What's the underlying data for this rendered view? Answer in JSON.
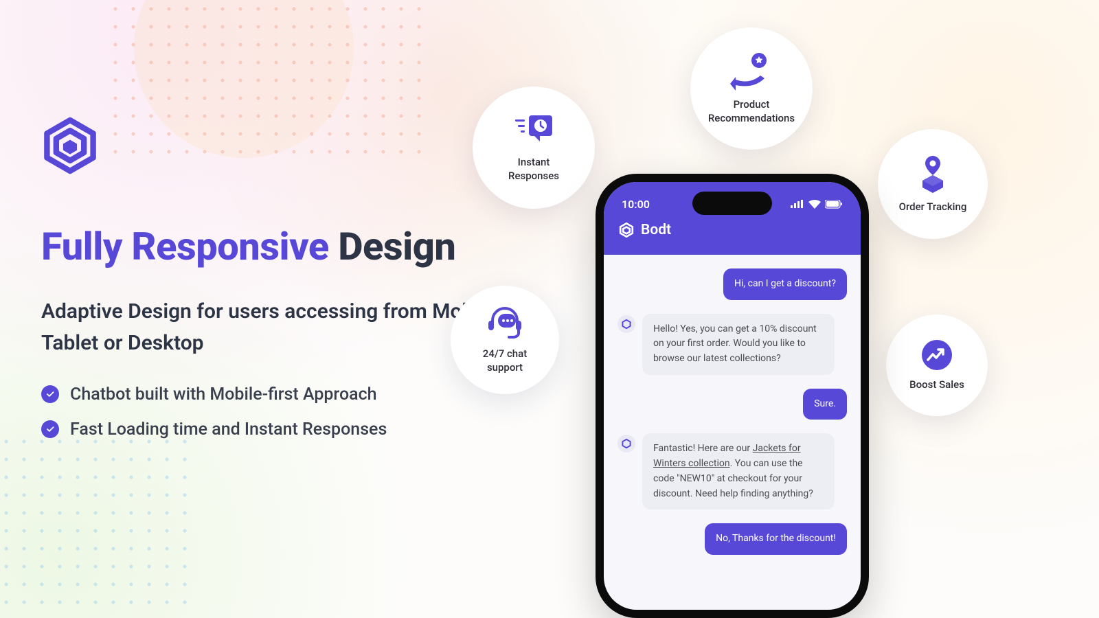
{
  "brand": {
    "accent": "#5748d8"
  },
  "headline": {
    "part1": "Fully Responsive ",
    "part2": "Design"
  },
  "subhead": "Adaptive Design for users accessing from Mobile, Tablet or Desktop",
  "bullets": [
    "Chatbot built with Mobile-first Approach",
    "Fast Loading time and Instant Responses"
  ],
  "phone": {
    "time": "10:00",
    "app_name": "Bodt",
    "messages": {
      "user1": "Hi, can I get a discount?",
      "bot1": "Hello! Yes, you can get a 10% discount on your first order. Would you like to browse our latest collections?",
      "user2": "Sure.",
      "bot2_pre": "Fantastic! Here are our ",
      "bot2_link": "Jackets for Winters collection",
      "bot2_post": ". You can use the code \"NEW10\" at checkout for your discount. Need help finding anything?",
      "user3": "No, Thanks for the discount!"
    }
  },
  "badges": {
    "instant": "Instant Responses",
    "recommendations": "Product Recommendations",
    "tracking": "Order Tracking",
    "support": "24/7 chat support",
    "sales": "Boost Sales"
  }
}
